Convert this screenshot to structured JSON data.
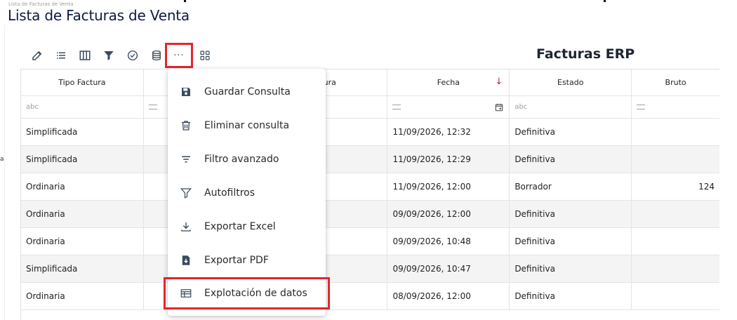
{
  "window": {
    "tiny_title": "Lista de Facturas de Venta",
    "page_title": "Lista de Facturas de Venta",
    "left_mark": "a"
  },
  "toolbar": {
    "buttons": [
      {
        "name": "edit-icon"
      },
      {
        "name": "list-icon"
      },
      {
        "name": "columns-icon"
      },
      {
        "name": "filter-icon"
      },
      {
        "name": "check-circle-icon"
      },
      {
        "name": "database-icon"
      },
      {
        "name": "more-icon",
        "label": "···",
        "highlighted": true
      },
      {
        "name": "grid-view-icon"
      }
    ],
    "highlight_color": "#e3262b"
  },
  "grid": {
    "title": "Facturas ERP",
    "columns": [
      "Tipo Factura",
      "",
      "ctura",
      "Fecha",
      "Estado",
      "Bruto"
    ],
    "sort_indicator": "↓",
    "filter_text_hint": "abc",
    "rows": [
      {
        "tipo": "Simplificada",
        "fecha": "11/09/2026, 12:32",
        "estado": "Definitiva",
        "bruto": ""
      },
      {
        "tipo": "Simplificada",
        "fecha": "11/09/2026, 12:29",
        "estado": "Definitiva",
        "bruto": ""
      },
      {
        "tipo": "Ordinaria",
        "fecha": "11/09/2026, 12:00",
        "estado": "Borrador",
        "bruto": "124"
      },
      {
        "tipo": "Ordinaria",
        "fecha": "09/09/2026, 12:00",
        "estado": "Definitiva",
        "bruto": ""
      },
      {
        "tipo": "Ordinaria",
        "fecha": "09/09/2026, 10:48",
        "estado": "Definitiva",
        "bruto": ""
      },
      {
        "tipo": "Simplificada",
        "fecha": "09/09/2026, 10:47",
        "estado": "Definitiva",
        "bruto": ""
      },
      {
        "tipo": "Ordinaria",
        "fecha": "08/09/2026, 12:00",
        "estado": "Definitiva",
        "bruto": ""
      }
    ]
  },
  "menu": {
    "items": [
      {
        "label": "Guardar Consulta",
        "icon": "save-icon"
      },
      {
        "label": "Eliminar consulta",
        "icon": "trash-icon"
      },
      {
        "label": "Filtro avanzado",
        "icon": "advanced-filter-icon"
      },
      {
        "label": "Autofiltros",
        "icon": "funnel-icon"
      },
      {
        "label": "Exportar Excel",
        "icon": "download-icon"
      },
      {
        "label": "Exportar PDF",
        "icon": "pdf-file-icon"
      },
      {
        "label": "Explotación de datos",
        "icon": "table-icon",
        "highlighted": true
      }
    ]
  }
}
